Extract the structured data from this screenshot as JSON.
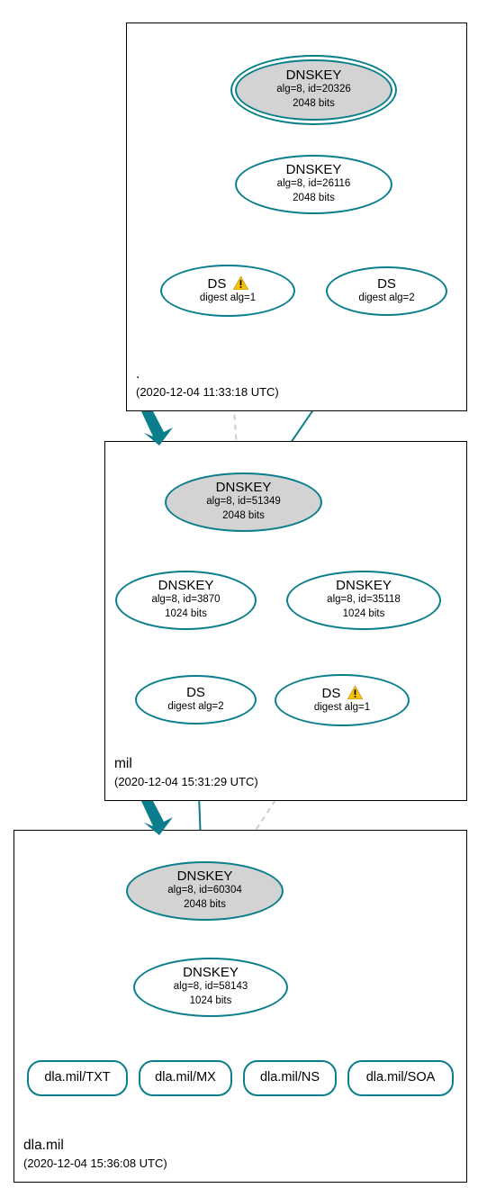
{
  "zones": {
    "root": {
      "title": ".",
      "ts": "(2020-12-04 11:33:18 UTC)"
    },
    "mil": {
      "title": "mil",
      "ts": "(2020-12-04 15:31:29 UTC)"
    },
    "dla": {
      "title": "dla.mil",
      "ts": "(2020-12-04 15:36:08 UTC)"
    }
  },
  "nodes": {
    "root_ksk": {
      "l1": "DNSKEY",
      "l2": "alg=8, id=20326",
      "l3": "2048 bits"
    },
    "root_zsk": {
      "l1": "DNSKEY",
      "l2": "alg=8, id=26116",
      "l3": "2048 bits"
    },
    "root_ds1": {
      "ds": "DS",
      "sub": "digest alg=1"
    },
    "root_ds2": {
      "ds": "DS",
      "sub": "digest alg=2"
    },
    "mil_ksk": {
      "l1": "DNSKEY",
      "l2": "alg=8, id=51349",
      "l3": "2048 bits"
    },
    "mil_zsk1": {
      "l1": "DNSKEY",
      "l2": "alg=8, id=3870",
      "l3": "1024 bits"
    },
    "mil_zsk2": {
      "l1": "DNSKEY",
      "l2": "alg=8, id=35118",
      "l3": "1024 bits"
    },
    "mil_ds2": {
      "ds": "DS",
      "sub": "digest alg=2"
    },
    "mil_ds1": {
      "ds": "DS",
      "sub": "digest alg=1"
    },
    "dla_ksk": {
      "l1": "DNSKEY",
      "l2": "alg=8, id=60304",
      "l3": "2048 bits"
    },
    "dla_zsk": {
      "l1": "DNSKEY",
      "l2": "alg=8, id=58143",
      "l3": "1024 bits"
    },
    "rr_txt": "dla.mil/TXT",
    "rr_mx": "dla.mil/MX",
    "rr_ns": "dla.mil/NS",
    "rr_soa": "dla.mil/SOA"
  },
  "chart_data": {
    "type": "graph",
    "zones": [
      {
        "name": ".",
        "timestamp": "2020-12-04 11:33:18 UTC"
      },
      {
        "name": "mil",
        "timestamp": "2020-12-04 15:31:29 UTC"
      },
      {
        "name": "dla.mil",
        "timestamp": "2020-12-04 15:36:08 UTC"
      }
    ],
    "nodes": [
      {
        "id": "root_ksk",
        "zone": ".",
        "type": "DNSKEY",
        "alg": 8,
        "key_id": 20326,
        "bits": 2048,
        "ksk": true,
        "trust_anchor": true
      },
      {
        "id": "root_zsk",
        "zone": ".",
        "type": "DNSKEY",
        "alg": 8,
        "key_id": 26116,
        "bits": 2048,
        "ksk": false
      },
      {
        "id": "root_ds1",
        "zone": ".",
        "type": "DS",
        "digest_alg": 1,
        "warning": true
      },
      {
        "id": "root_ds2",
        "zone": ".",
        "type": "DS",
        "digest_alg": 2
      },
      {
        "id": "mil_ksk",
        "zone": "mil",
        "type": "DNSKEY",
        "alg": 8,
        "key_id": 51349,
        "bits": 2048,
        "ksk": true
      },
      {
        "id": "mil_zsk1",
        "zone": "mil",
        "type": "DNSKEY",
        "alg": 8,
        "key_id": 3870,
        "bits": 1024,
        "ksk": false
      },
      {
        "id": "mil_zsk2",
        "zone": "mil",
        "type": "DNSKEY",
        "alg": 8,
        "key_id": 35118,
        "bits": 1024,
        "ksk": false
      },
      {
        "id": "mil_ds2",
        "zone": "mil",
        "type": "DS",
        "digest_alg": 2
      },
      {
        "id": "mil_ds1",
        "zone": "mil",
        "type": "DS",
        "digest_alg": 1,
        "warning": true
      },
      {
        "id": "dla_ksk",
        "zone": "dla.mil",
        "type": "DNSKEY",
        "alg": 8,
        "key_id": 60304,
        "bits": 2048,
        "ksk": true
      },
      {
        "id": "dla_zsk",
        "zone": "dla.mil",
        "type": "DNSKEY",
        "alg": 8,
        "key_id": 58143,
        "bits": 1024,
        "ksk": false
      },
      {
        "id": "rr_txt",
        "zone": "dla.mil",
        "type": "RRset",
        "name": "dla.mil",
        "rrtype": "TXT"
      },
      {
        "id": "rr_mx",
        "zone": "dla.mil",
        "type": "RRset",
        "name": "dla.mil",
        "rrtype": "MX"
      },
      {
        "id": "rr_ns",
        "zone": "dla.mil",
        "type": "RRset",
        "name": "dla.mil",
        "rrtype": "NS"
      },
      {
        "id": "rr_soa",
        "zone": "dla.mil",
        "type": "RRset",
        "name": "dla.mil",
        "rrtype": "SOA"
      }
    ],
    "edges": [
      {
        "from": "root_ksk",
        "to": "root_ksk",
        "style": "solid",
        "color": "#0a7e8c",
        "kind": "self-sign"
      },
      {
        "from": "root_ksk",
        "to": "root_zsk",
        "style": "solid",
        "color": "#0a7e8c"
      },
      {
        "from": "root_zsk",
        "to": "root_ds1",
        "style": "solid",
        "color": "#0a7e8c"
      },
      {
        "from": "root_zsk",
        "to": "root_ds2",
        "style": "solid",
        "color": "#0a7e8c"
      },
      {
        "from": "root_ds1",
        "to": "mil_ksk",
        "style": "dashed",
        "color": "#cccccc"
      },
      {
        "from": "root_ds2",
        "to": "mil_ksk",
        "style": "solid",
        "color": "#0a7e8c"
      },
      {
        "from": "mil_ksk",
        "to": "mil_ksk",
        "style": "solid",
        "color": "#0a7e8c",
        "kind": "self-sign"
      },
      {
        "from": "mil_ksk",
        "to": "mil_zsk1",
        "style": "solid",
        "color": "#0a7e8c"
      },
      {
        "from": "mil_ksk",
        "to": "mil_zsk2",
        "style": "solid",
        "color": "#0a7e8c"
      },
      {
        "from": "mil_zsk1",
        "to": "mil_zsk1",
        "style": "solid",
        "color": "#0a7e8c",
        "kind": "self-sign"
      },
      {
        "from": "mil_zsk1",
        "to": "mil_ds2",
        "style": "solid",
        "color": "#0a7e8c"
      },
      {
        "from": "mil_zsk1",
        "to": "mil_ds1",
        "style": "solid",
        "color": "#0a7e8c"
      },
      {
        "from": "mil_ds2",
        "to": "dla_ksk",
        "style": "solid",
        "color": "#0a7e8c"
      },
      {
        "from": "mil_ds1",
        "to": "dla_ksk",
        "style": "dashed",
        "color": "#cccccc"
      },
      {
        "from": "dla_ksk",
        "to": "dla_ksk",
        "style": "solid",
        "color": "#0a7e8c",
        "kind": "self-sign"
      },
      {
        "from": "dla_ksk",
        "to": "dla_zsk",
        "style": "solid",
        "color": "#0a7e8c"
      },
      {
        "from": "dla_zsk",
        "to": "dla_zsk",
        "style": "solid",
        "color": "#0a7e8c",
        "kind": "self-sign"
      },
      {
        "from": "dla_zsk",
        "to": "rr_txt",
        "style": "solid",
        "color": "#0a7e8c"
      },
      {
        "from": "dla_zsk",
        "to": "rr_mx",
        "style": "solid",
        "color": "#0a7e8c"
      },
      {
        "from": "dla_zsk",
        "to": "rr_ns",
        "style": "solid",
        "color": "#0a7e8c"
      },
      {
        "from": "dla_zsk",
        "to": "rr_soa",
        "style": "solid",
        "color": "#0a7e8c"
      }
    ],
    "delegations": [
      {
        "from_zone": ".",
        "to_zone": "mil"
      },
      {
        "from_zone": "mil",
        "to_zone": "dla.mil"
      }
    ]
  }
}
